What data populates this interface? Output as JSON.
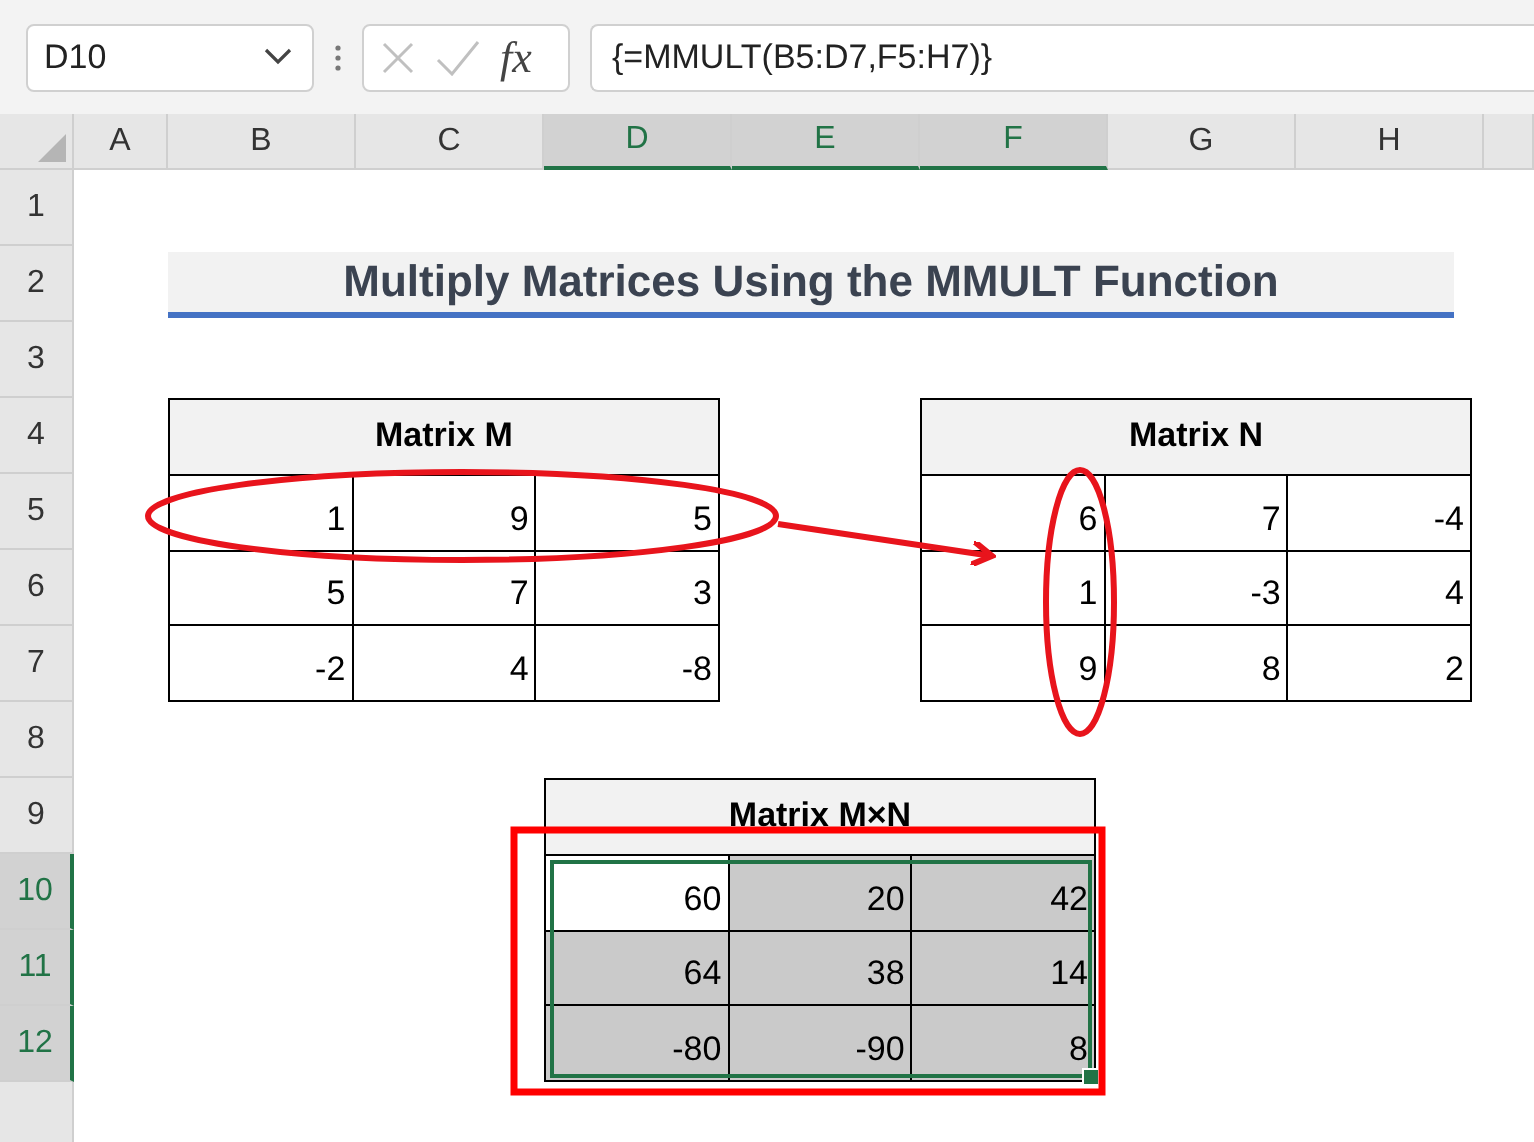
{
  "name_box": {
    "value": "D10"
  },
  "formula_bar": {
    "function_label": "fx",
    "formula": "{=MMULT(B5:D7,F5:H7)}"
  },
  "columns": [
    {
      "label": "A",
      "selected": false
    },
    {
      "label": "B",
      "selected": false
    },
    {
      "label": "C",
      "selected": false
    },
    {
      "label": "D",
      "selected": true
    },
    {
      "label": "E",
      "selected": true
    },
    {
      "label": "F",
      "selected": true
    },
    {
      "label": "G",
      "selected": false
    },
    {
      "label": "H",
      "selected": false
    }
  ],
  "rows": [
    {
      "label": "1",
      "selected": false
    },
    {
      "label": "2",
      "selected": false
    },
    {
      "label": "3",
      "selected": false
    },
    {
      "label": "4",
      "selected": false
    },
    {
      "label": "5",
      "selected": false
    },
    {
      "label": "6",
      "selected": false
    },
    {
      "label": "7",
      "selected": false
    },
    {
      "label": "8",
      "selected": false
    },
    {
      "label": "9",
      "selected": false
    },
    {
      "label": "10",
      "selected": true
    },
    {
      "label": "11",
      "selected": true
    },
    {
      "label": "12",
      "selected": true
    }
  ],
  "title": "Multiply Matrices Using the MMULT Function",
  "matrices": [
    {
      "title": "Matrix M",
      "selected": false,
      "values": [
        [
          "1",
          "9",
          "5"
        ],
        [
          "5",
          "7",
          "3"
        ],
        [
          "-2",
          "4",
          "-8"
        ]
      ]
    },
    {
      "title": "Matrix N",
      "selected": false,
      "values": [
        [
          "6",
          "7",
          "-4"
        ],
        [
          "1",
          "-3",
          "4"
        ],
        [
          "9",
          "8",
          "2"
        ]
      ]
    },
    {
      "title": "Matrix M×N",
      "selected": true,
      "values": [
        [
          {
            "value": "60",
            "active": true
          },
          {
            "value": "20",
            "active": false
          },
          {
            "value": "42",
            "active": false
          }
        ],
        [
          {
            "value": "64",
            "active": false
          },
          {
            "value": "38",
            "active": false
          },
          {
            "value": "14",
            "active": false
          }
        ],
        [
          {
            "value": "-80",
            "active": false
          },
          {
            "value": "-90",
            "active": false
          },
          {
            "value": "8",
            "active": false
          }
        ]
      ]
    }
  ]
}
